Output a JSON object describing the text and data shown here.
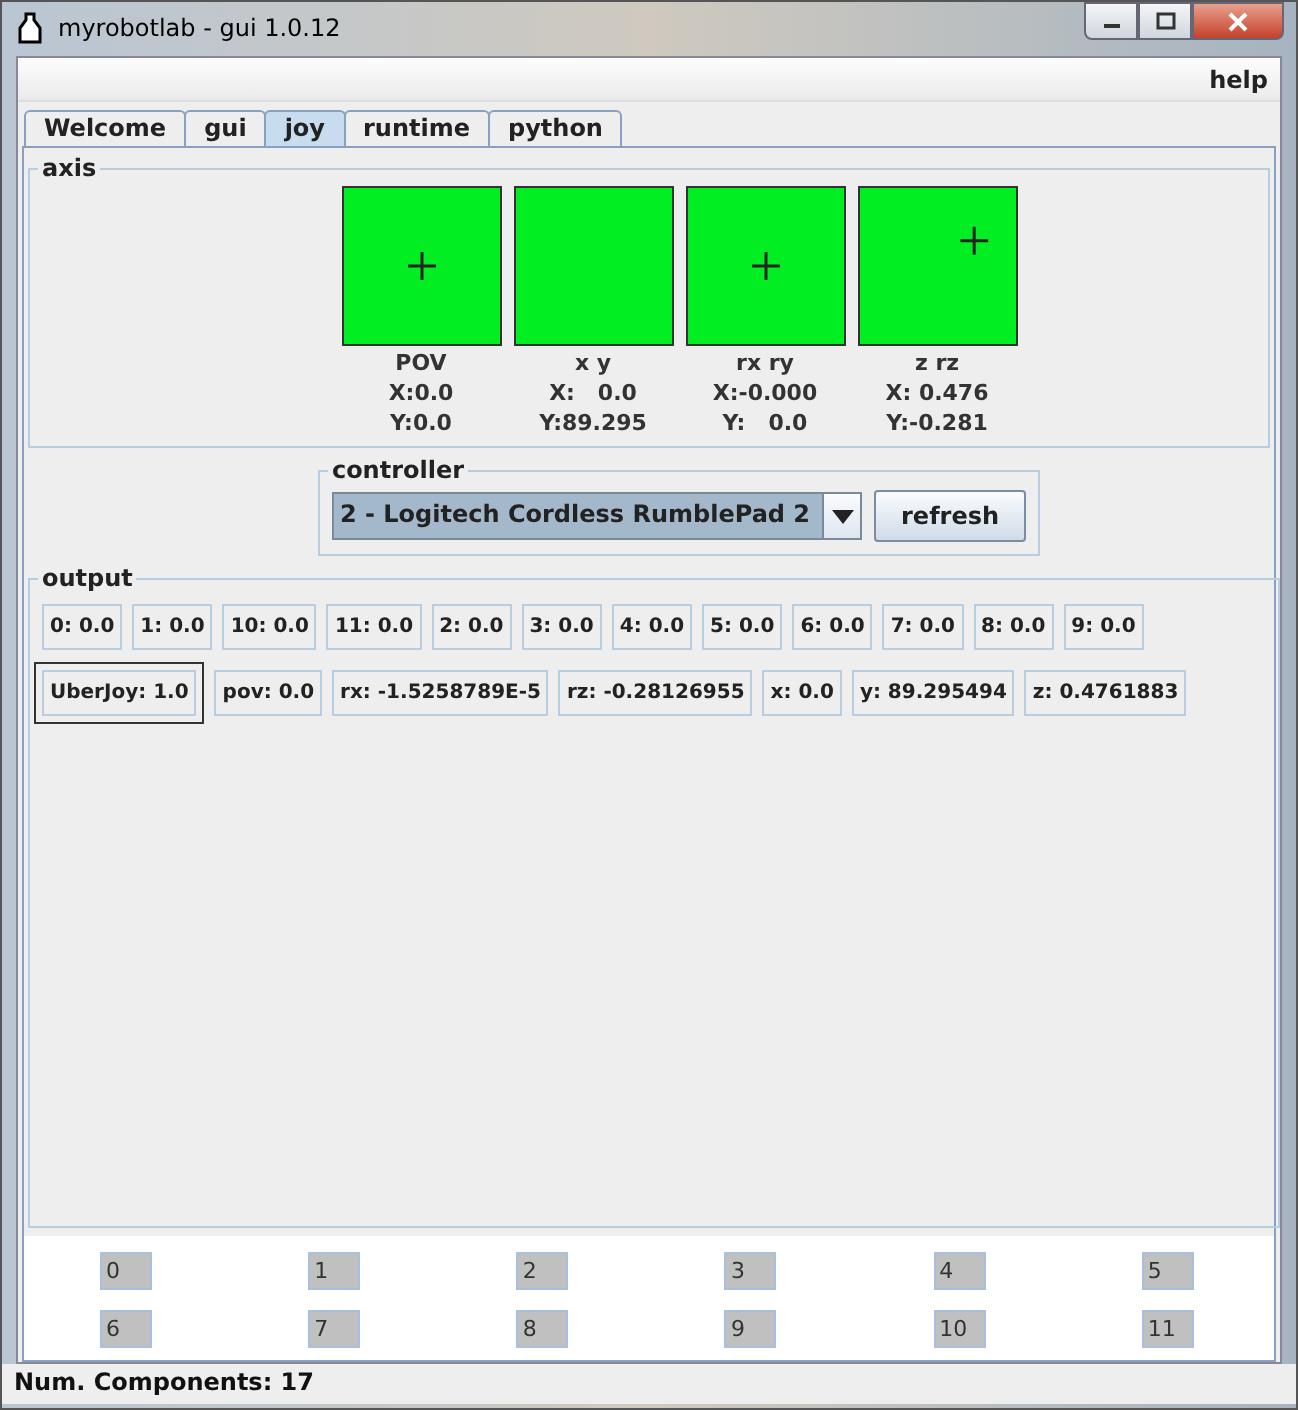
{
  "window": {
    "title": "myrobotlab - gui 1.0.12"
  },
  "menu": {
    "items": [
      "help"
    ]
  },
  "tabs": [
    {
      "label": "Welcome",
      "selected": false
    },
    {
      "label": "gui",
      "selected": false
    },
    {
      "label": "joy",
      "selected": true
    },
    {
      "label": "runtime",
      "selected": false
    },
    {
      "label": "python",
      "selected": false
    }
  ],
  "axis": {
    "title": "axis",
    "pads": [
      {
        "label": "POV",
        "x": "X:0.0",
        "y": "Y:0.0",
        "crosshair": true
      },
      {
        "label": "x y",
        "x": "X:   0.0",
        "y": "Y:89.295",
        "crosshair": false
      },
      {
        "label": "rx ry",
        "x": "X:-0.000",
        "y": "Y:   0.0",
        "crosshair": true
      },
      {
        "label": "z rz",
        "x": "X: 0.476",
        "y": "Y:-0.281",
        "crosshair": true
      }
    ]
  },
  "controller": {
    "title": "controller",
    "value": "2 - Logitech Cordless RumblePad 2",
    "button": "refresh"
  },
  "output": {
    "title": "output",
    "values": [
      {
        "text": "0: 0.0",
        "focused": false
      },
      {
        "text": "1: 0.0",
        "focused": false
      },
      {
        "text": "10: 0.0",
        "focused": false
      },
      {
        "text": "11: 0.0",
        "focused": false
      },
      {
        "text": "2: 0.0",
        "focused": false
      },
      {
        "text": "3: 0.0",
        "focused": false
      },
      {
        "text": "4: 0.0",
        "focused": false
      },
      {
        "text": "5: 0.0",
        "focused": false
      },
      {
        "text": "6: 0.0",
        "focused": false
      },
      {
        "text": "7: 0.0",
        "focused": false
      },
      {
        "text": "8: 0.0",
        "focused": false
      },
      {
        "text": "9: 0.0",
        "focused": false
      },
      {
        "text": "UberJoy: 1.0",
        "focused": true
      },
      {
        "text": "pov: 0.0",
        "focused": false
      },
      {
        "text": "rx: -1.5258789E-5",
        "focused": false
      },
      {
        "text": "rz: -0.28126955",
        "focused": false
      },
      {
        "text": "x: 0.0",
        "focused": false
      },
      {
        "text": "y: 89.295494",
        "focused": false
      },
      {
        "text": "z: 0.4761883",
        "focused": false
      }
    ]
  },
  "buttons": [
    "0",
    "1",
    "2",
    "3",
    "4",
    "5",
    "6",
    "7",
    "8",
    "9",
    "10",
    "11"
  ],
  "status_bar": "Num. Components: 17"
}
